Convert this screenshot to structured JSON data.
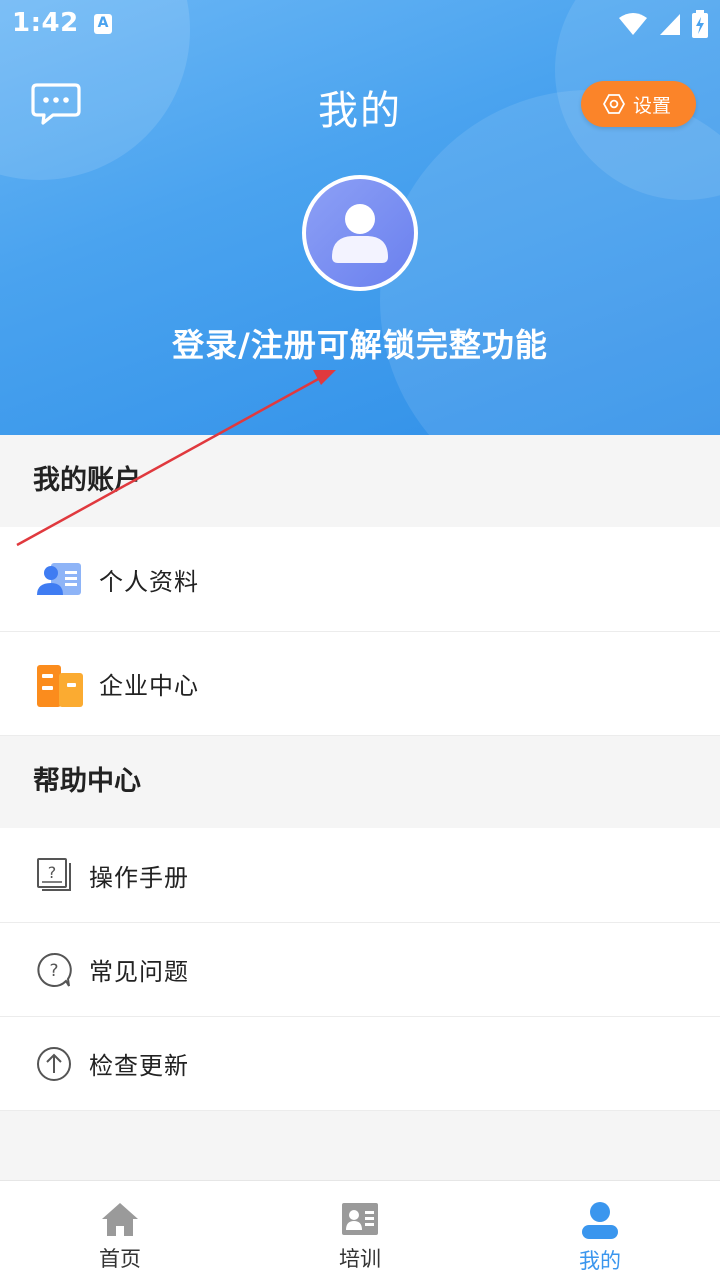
{
  "status_bar": {
    "time": "1:42",
    "notification_icon": "A"
  },
  "header": {
    "title": "我的",
    "settings_label": "设置",
    "login_prompt": "登录/注册可解锁完整功能"
  },
  "account_section": {
    "title": "我的账户",
    "items": [
      {
        "label": "个人资料",
        "icon": "profile-card-icon"
      },
      {
        "label": "企业中心",
        "icon": "building-icon"
      }
    ]
  },
  "help_section": {
    "title": "帮助中心",
    "items": [
      {
        "label": "操作手册",
        "icon": "manual-icon"
      },
      {
        "label": "常见问题",
        "icon": "question-icon"
      },
      {
        "label": "检查更新",
        "icon": "update-arrow-icon"
      }
    ]
  },
  "bottom_nav": {
    "items": [
      {
        "label": "首页",
        "icon": "home-icon"
      },
      {
        "label": "培训",
        "icon": "training-icon"
      },
      {
        "label": "我的",
        "icon": "user-icon",
        "active": true
      }
    ]
  },
  "colors": {
    "header_blue": "#4aa3ef",
    "settings_orange": "#fb8429",
    "active_tab": "#3a96ee",
    "annotation_arrow": "#e0393e"
  }
}
